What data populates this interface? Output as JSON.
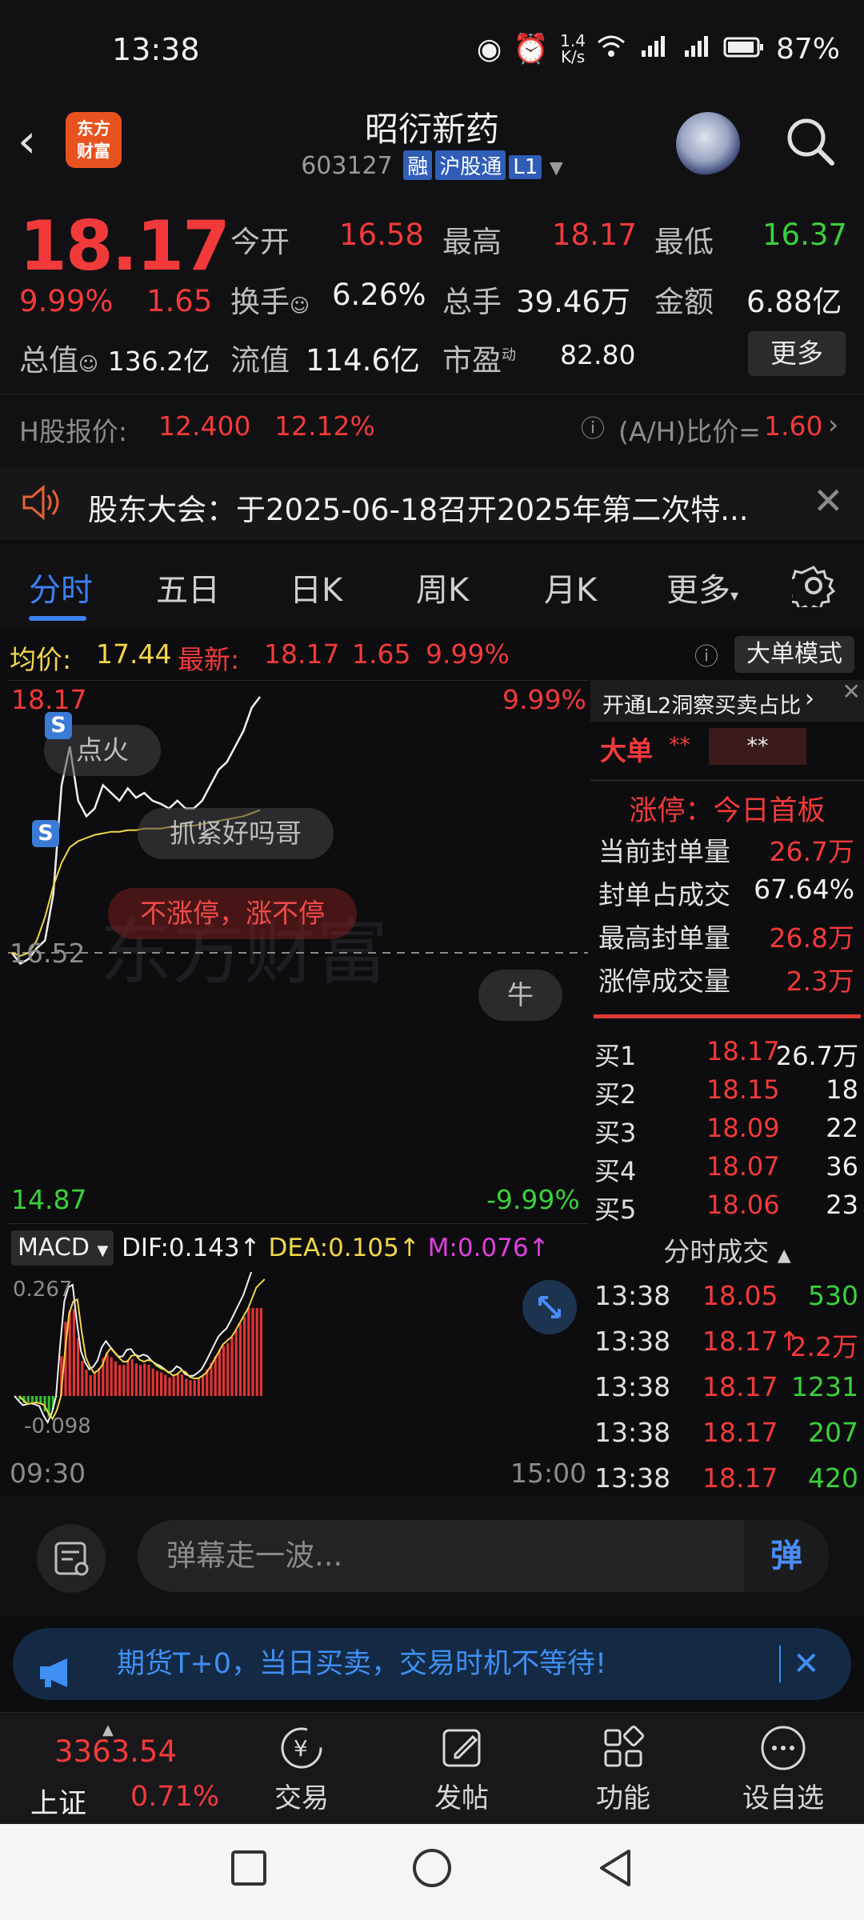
{
  "status": {
    "time": "13:38",
    "speed_top": "1.4",
    "speed_unit": "K/s",
    "battery": "87%"
  },
  "header": {
    "logo_line1": "东方",
    "logo_line2": "财富",
    "name": "昭衍新药",
    "code": "603127",
    "tags": [
      "融",
      "沪股通",
      "L1"
    ]
  },
  "quote": {
    "price": "18.17",
    "pct": "9.99%",
    "chg": "1.65",
    "open_label": "今开",
    "open": "16.58",
    "high_label": "最高",
    "high": "18.17",
    "low_label": "最低",
    "low": "16.37",
    "turnover_label": "换手",
    "turnover": "6.26%",
    "volume_label": "总手",
    "volume": "39.46万",
    "amount_label": "金额",
    "amount": "6.88亿",
    "mcap_label": "总值",
    "mcap": "136.2亿",
    "float_label": "流值",
    "float": "114.6亿",
    "pe_label": "市盈",
    "pe_sup": "动",
    "pe": "82.80",
    "more": "更多"
  },
  "hshare": {
    "label": "H股报价:",
    "price": "12.400",
    "pct": "12.12%",
    "ratio_label": "(A/H)比价=",
    "ratio": "1.60"
  },
  "notice": {
    "text": "股东大会：于2025-06-18召开2025年第二次特..."
  },
  "tabs": [
    "分时",
    "五日",
    "日K",
    "周K",
    "月K",
    "更多"
  ],
  "info": {
    "avg_label": "均价:",
    "avg": "17.44",
    "latest_label": "最新:",
    "latest": "18.17",
    "chg": "1.65",
    "pct": "9.99%",
    "bigmode": "大单模式"
  },
  "chart": {
    "top_price": "18.17",
    "top_pct": "9.99%",
    "bottom_price": "14.87",
    "bottom_pct": "-9.99%",
    "mid_price": "16.52",
    "start_time": "09:30",
    "end_time": "15:00",
    "bubbles": [
      "点火",
      "抓紧好吗哥",
      "不涨停，涨不停",
      "牛"
    ],
    "signal": "S",
    "watermark": "东方财富"
  },
  "chart_data": {
    "type": "line",
    "title": "",
    "x_range": [
      "09:30",
      "15:00"
    ],
    "ylim": [
      14.87,
      18.17
    ],
    "prev_close": 16.52,
    "series": [
      {
        "name": "price",
        "values": [
          16.52,
          16.45,
          16.48,
          16.55,
          16.6,
          16.9,
          17.6,
          17.85,
          17.5,
          17.4,
          17.45,
          17.6,
          17.55,
          17.5,
          17.58,
          17.52,
          17.55,
          17.5,
          17.48,
          17.45,
          17.5,
          17.45,
          17.45,
          17.5,
          17.6,
          17.7,
          17.75,
          17.85,
          17.95,
          18.1,
          18.17
        ]
      },
      {
        "name": "avg",
        "values": [
          16.52,
          16.5,
          16.52,
          16.6,
          16.75,
          16.95,
          17.1,
          17.2,
          17.24,
          17.26,
          17.28,
          17.29,
          17.3,
          17.3,
          17.31,
          17.31,
          17.32,
          17.32,
          17.32,
          17.33,
          17.33,
          17.34,
          17.34,
          17.35,
          17.36,
          17.37,
          17.38,
          17.39,
          17.4,
          17.42,
          17.44
        ]
      }
    ]
  },
  "macd": {
    "label": "MACD",
    "dif_label": "DIF:",
    "dif": "0.143",
    "dea_label": "DEA:",
    "dea": "0.105",
    "m_label": "M:",
    "m": "0.076",
    "top": "0.267",
    "bottom": "-0.098"
  },
  "side": {
    "promo": "开通L2洞察买卖占比",
    "big_label": "大单",
    "big_val1": "**",
    "big_val2": "**",
    "limit_label": "涨停：今日首板",
    "rows": [
      {
        "k": "当前封单量",
        "v": "26.7万"
      },
      {
        "k": "封单占成交",
        "v": "67.64%"
      },
      {
        "k": "最高封单量",
        "v": "26.8万"
      },
      {
        "k": "涨停成交量",
        "v": "2.3万"
      }
    ],
    "bids": [
      {
        "k": "买1",
        "p": "18.17",
        "v": "26.7万"
      },
      {
        "k": "买2",
        "p": "18.15",
        "v": "18"
      },
      {
        "k": "买3",
        "p": "18.09",
        "v": "22"
      },
      {
        "k": "买4",
        "p": "18.07",
        "v": "36"
      },
      {
        "k": "买5",
        "p": "18.06",
        "v": "23"
      }
    ],
    "trades_title": "分时成交",
    "trades": [
      {
        "t": "13:38",
        "p": "18.05",
        "v": "530"
      },
      {
        "t": "13:38",
        "p": "18.17↑",
        "v": "2.2万"
      },
      {
        "t": "13:38",
        "p": "18.17",
        "v": "1231"
      },
      {
        "t": "13:38",
        "p": "18.17",
        "v": "207"
      },
      {
        "t": "13:38",
        "p": "18.17",
        "v": "420"
      }
    ]
  },
  "danmu": {
    "placeholder": "弹幕走一波...",
    "send": "弹"
  },
  "ad": {
    "text": "期货T+0，当日买卖，交易时机不等待!"
  },
  "nav": {
    "index_value": "3363.54",
    "index_name": "上证",
    "index_pct": "0.71%",
    "items": [
      "交易",
      "发帖",
      "功能",
      "设自选"
    ]
  },
  "colors": {
    "up": "#f23a3a",
    "down": "#3ad13a",
    "accent": "#3d7ff2",
    "bg": "#0d0d0f"
  }
}
